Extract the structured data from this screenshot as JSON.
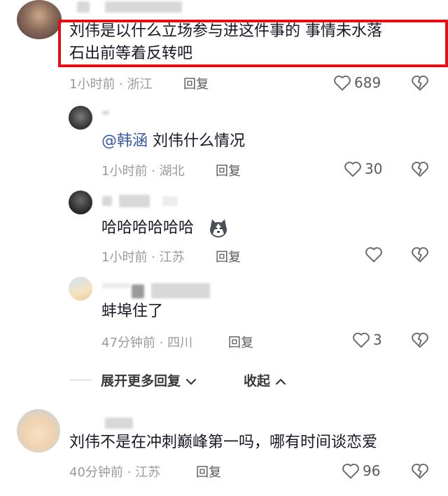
{
  "comments": [
    {
      "text_line1": "刘伟是以什么立场参与进这件事的 事情未水落",
      "text_line2": "石出前等着反转吧",
      "time": "1小时前",
      "location": "浙江",
      "reply_label": "回复",
      "likes": "689"
    },
    {
      "mention": "@韩涵",
      "text": " 刘伟什么情况",
      "time": "1小时前",
      "location": "湖北",
      "reply_label": "回复",
      "likes": "30"
    },
    {
      "text": "哈哈哈哈哈哈",
      "time": "1小时前",
      "location": "江苏",
      "reply_label": "回复",
      "likes": ""
    },
    {
      "text": "蚌埠住了",
      "time": "47分钟前",
      "location": "四川",
      "reply_label": "回复",
      "likes": "3"
    },
    {
      "text": "刘伟不是在冲刺巅峰第一吗，哪有时间谈恋爱",
      "time": "40分钟前",
      "location": "江苏",
      "reply_label": "回复",
      "likes": "96"
    }
  ],
  "expand_more_label": "展开更多回复",
  "collapse_label": "收起",
  "separator": "·",
  "icons": {
    "like": "heart-outline-icon",
    "dislike": "broken-heart-icon",
    "expand": "chevron-down-icon",
    "collapse": "chevron-up-icon",
    "emoji": "husky-dog-emoji-icon"
  },
  "colors": {
    "highlight_border": "#d9121b",
    "mention": "#3d5a9a",
    "meta": "#9a9a9a"
  }
}
